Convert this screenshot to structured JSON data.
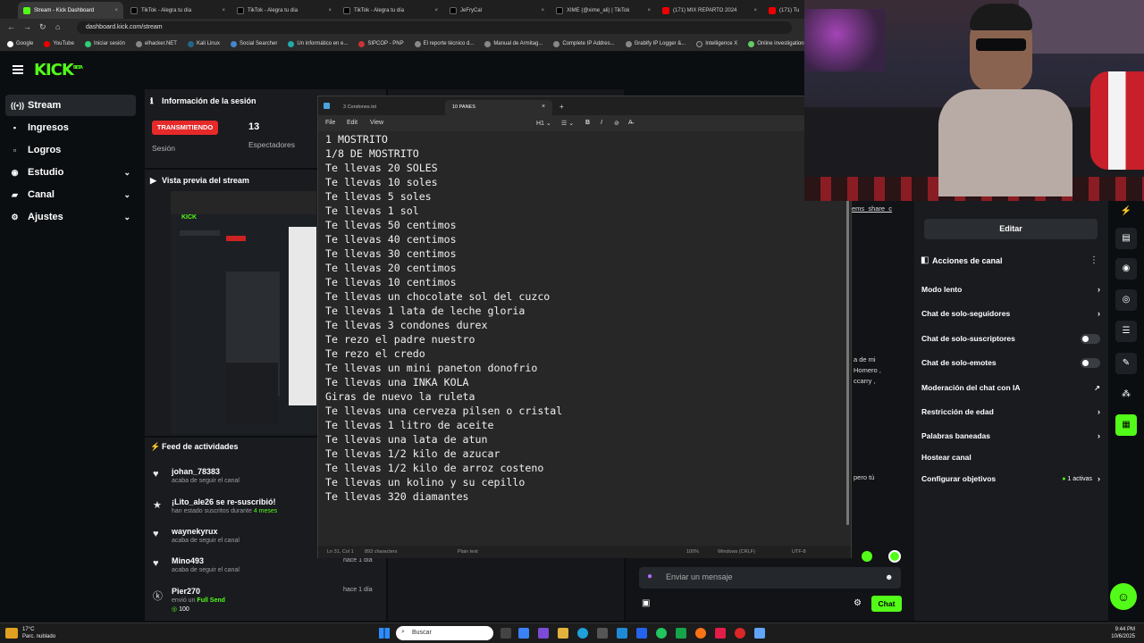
{
  "browser": {
    "tabs": [
      {
        "title": "Stream - Kick Dashboard"
      },
      {
        "title": "TikTok - Alegra tu día"
      },
      {
        "title": "TikTok - Alegra tu día"
      },
      {
        "title": "TikTok - Alegra tu día"
      },
      {
        "title": "JeFryCal"
      },
      {
        "title": "XIME (@xime_ali) | TikTok"
      },
      {
        "title": "(171) MIX REPARTO 2024"
      },
      {
        "title": "(171) Tu"
      }
    ],
    "url": "dashboard.kick.com/stream",
    "bookmarks": [
      "Google",
      "YouTube",
      "Iniciar sesión",
      "elhacker.NET",
      "Kali Linux",
      "Social Searcher",
      "Un informático en e...",
      "SIPCOP - PNP",
      "El reporte técnico d...",
      "Manual de Armitag...",
      "Complete IP Addres...",
      "Grabify IP Logger &...",
      "Intelligence X",
      "Online investigation..."
    ]
  },
  "kick": {
    "logo": "KICK",
    "logo_sup": "BETA",
    "sidebar": [
      {
        "label": "Stream",
        "icon": "radio-icon"
      },
      {
        "label": "Ingresos",
        "icon": "wallet-icon"
      },
      {
        "label": "Logros",
        "icon": "trophy-icon"
      },
      {
        "label": "Estudio",
        "icon": "palette-icon",
        "chev": "⌄"
      },
      {
        "label": "Canal",
        "icon": "channel-icon",
        "chev": "⌄"
      },
      {
        "label": "Ajustes",
        "icon": "gear-icon",
        "chev": "⌄"
      }
    ],
    "session": {
      "title": "Información de la sesión",
      "live_badge": "TRANSMITIENDO",
      "live_label": "Sesión",
      "viewers": "13",
      "viewers_label": "Espectadores"
    },
    "preview_title": "Vista previa del stream",
    "feed": {
      "title": "Feed de actividades",
      "items": [
        {
          "name": "johan_78383",
          "sub": "acaba de seguir el canal",
          "time": ""
        },
        {
          "name": "¡Lito_ale26 se re-suscribió!",
          "sub": "han estado suscritos durante",
          "sub_highlight": "4 meses",
          "time": ""
        },
        {
          "name": "waynekyrux",
          "sub": "acaba de seguir el canal",
          "time": ""
        },
        {
          "name": "Mino493",
          "sub": "acaba de seguir el canal",
          "time": "hace 1 día"
        },
        {
          "name": "Pier270",
          "sub": "envió un",
          "sub_highlight": "Full Send",
          "time": "hace 1 día",
          "amount": "100"
        }
      ]
    },
    "chat": {
      "fragments": [
        "ems_share_c",
        "a de mi",
        "Homero ,",
        "ccarry ,",
        "pero tú"
      ],
      "input_placeholder": "Enviar un mensaje",
      "send_label": "Chat"
    },
    "actions": {
      "edit_label": "Editar",
      "title": "Acciones de canal",
      "rows": [
        {
          "label": "Modo lento",
          "kind": "arrow"
        },
        {
          "label": "Chat de solo-seguidores",
          "kind": "arrow"
        },
        {
          "label": "Chat de solo-suscriptores",
          "kind": "toggle"
        },
        {
          "label": "Chat de solo-emotes",
          "kind": "toggle"
        },
        {
          "label": "Moderación del chat con IA",
          "kind": "external"
        },
        {
          "label": "Restricción de edad",
          "kind": "arrow"
        },
        {
          "label": "Palabras baneadas",
          "kind": "arrow"
        },
        {
          "label": "Hostear canal",
          "kind": "none"
        },
        {
          "label": "Configurar objetivos",
          "kind": "arrow",
          "extra": "1 activas"
        }
      ]
    }
  },
  "notepad": {
    "tabs": [
      "3 Condones.txt",
      "10 PANES"
    ],
    "menu": [
      "File",
      "Edit",
      "View"
    ],
    "lines": [
      "1 MOSTRITO",
      "1/8 DE MOSTRITO",
      "Te llevas 20 SOLES",
      "Te llevas 10 soles",
      "Te llevas 5 soles",
      "Te llevas 1 sol",
      "Te llevas 50 centimos",
      "Te llevas 40 centimos",
      "Te llevas 30 centimos",
      "Te llevas 20 centimos",
      "Te llevas 10 centimos",
      "Te llevas un chocolate sol del cuzco",
      "Te llevas 1 lata de leche gloria",
      "Te llevas 3 condones durex",
      "Te rezo el padre nuestro",
      "Te rezo el credo",
      "Te llevas un mini paneton donofrio",
      "Te llevas una INKA KOLA",
      "Giras de nuevo la ruleta",
      "Te llevas una cerveza pilsen o cristal",
      "Te llevas 1 litro de aceite",
      "Te llevas una lata de atun",
      "Te llevas 1/2 kilo de azucar",
      "Te llevas 1/2 kilo de arroz costeno",
      "Te llevas un kolino y su cepillo",
      "Te llevas 320 diamantes"
    ],
    "status": {
      "position": "Ln 31, Col 1",
      "chars": "893 characters",
      "format": "Plain text",
      "zoom": "100%",
      "eol": "Windows (CRLF)",
      "encoding": "UTF-8"
    }
  },
  "taskbar": {
    "weather_temp": "17°C",
    "weather_desc": "Parc. nublado",
    "search": "Buscar",
    "time": "9:44 PM",
    "date": "10/6/2025"
  }
}
